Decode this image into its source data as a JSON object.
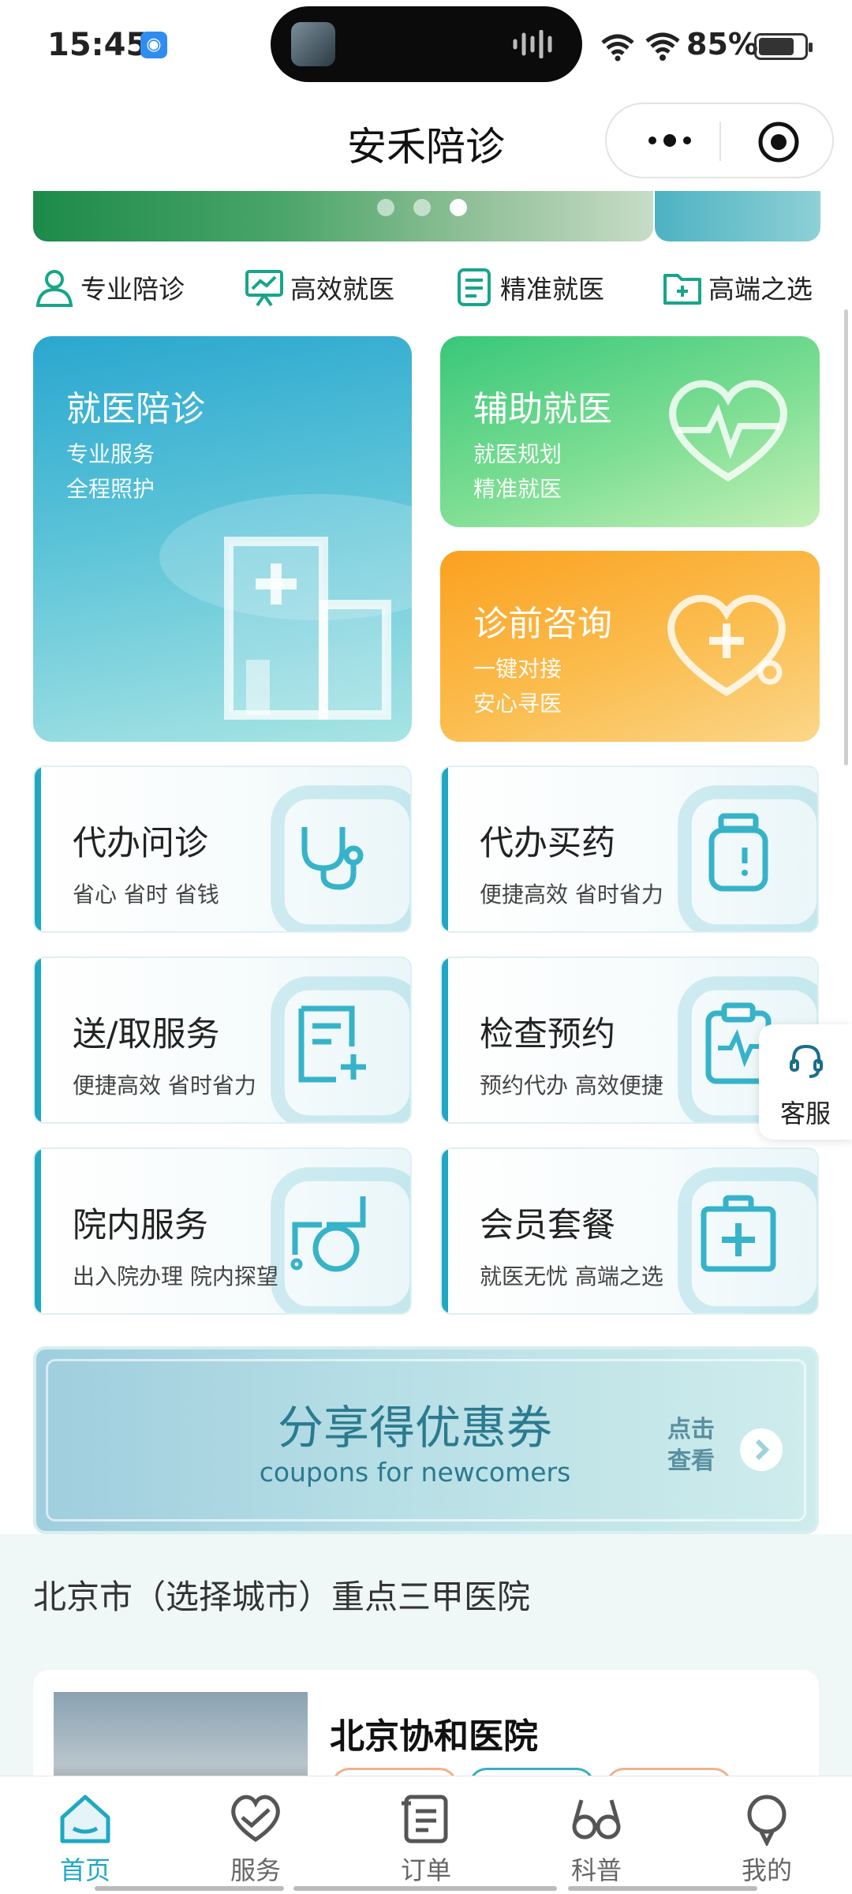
{
  "status_bar": {
    "time": "15:45",
    "battery": "85%",
    "icons": [
      "app-notification-icon",
      "signal-icon",
      "wifi-icon",
      "battery-icon"
    ]
  },
  "nav": {
    "title": "安禾陪诊",
    "icons": [
      "more-icon",
      "close-miniprogram-icon"
    ]
  },
  "features": [
    {
      "label": "专业陪诊",
      "icon": "person-icon"
    },
    {
      "label": "高效就医",
      "icon": "presentation-icon"
    },
    {
      "label": "精准就医",
      "icon": "document-icon"
    },
    {
      "label": "高端之选",
      "icon": "medical-folder-icon"
    }
  ],
  "big_cards": [
    {
      "title": "就医陪诊",
      "line1": "专业服务",
      "line2": "全程照护",
      "icon": "hospital-icon"
    },
    {
      "title": "辅助就医",
      "line1": "就医规划",
      "line2": "精准就医",
      "icon": "heartbeat-icon"
    },
    {
      "title": "诊前咨询",
      "line1": "一键对接",
      "line2": "安心寻医",
      "icon": "heart-stethoscope-icon"
    }
  ],
  "services": [
    {
      "title": "代办问诊",
      "sub": "省心 省时 省钱",
      "icon": "stethoscope-icon"
    },
    {
      "title": "代办买药",
      "sub": "便捷高效 省时省力",
      "icon": "medicine-bottle-icon"
    },
    {
      "title": "送/取服务",
      "sub": "便捷高效 省时省力",
      "icon": "add-document-icon"
    },
    {
      "title": "检查预约",
      "sub": "预约代办 高效便捷",
      "icon": "clipboard-pulse-icon"
    },
    {
      "title": "院内服务",
      "sub": "出入院办理 院内探望",
      "icon": "wheelchair-icon"
    },
    {
      "title": "会员套餐",
      "sub": "就医无忧 高端之选",
      "icon": "first-aid-kit-icon"
    }
  ],
  "customer_service": {
    "label": "客服",
    "icon": "headset-icon"
  },
  "coupon": {
    "title": "分享得优惠券",
    "subtitle": "coupons for newcomers",
    "action": "点击查看"
  },
  "section": {
    "title": "北京市（选择城市）重点三甲医院"
  },
  "hospital": {
    "name": "北京协和医院"
  },
  "tabs": [
    {
      "label": "首页",
      "icon": "home-icon",
      "active": true
    },
    {
      "label": "服务",
      "icon": "heart-icon",
      "active": false
    },
    {
      "label": "订单",
      "icon": "order-list-icon",
      "active": false
    },
    {
      "label": "科普",
      "icon": "glasses-icon",
      "active": false
    },
    {
      "label": "我的",
      "icon": "user-icon",
      "active": false
    }
  ],
  "colors": {
    "accent": "#1fa8c4",
    "card_teal": "#2aa7cf",
    "card_green": "#38c77a",
    "card_orange": "#fba11f"
  }
}
